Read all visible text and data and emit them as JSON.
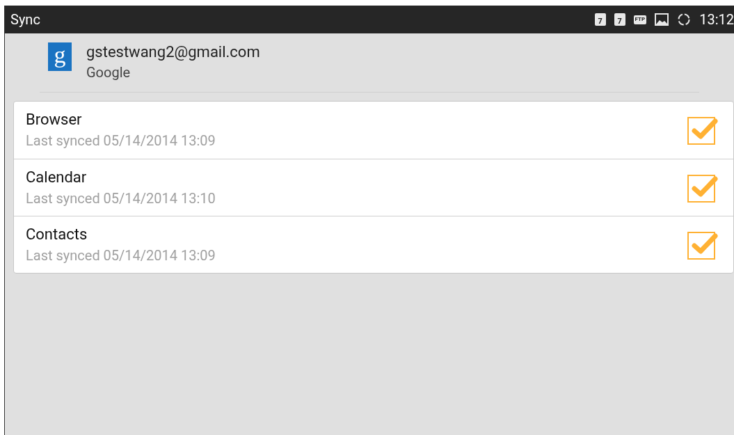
{
  "status_bar": {
    "title": "Sync",
    "icons": [
      {
        "kind": "calendar",
        "text": "7"
      },
      {
        "kind": "calendar",
        "text": "7"
      },
      {
        "kind": "ftp",
        "text": "FTP"
      },
      {
        "kind": "picture"
      },
      {
        "kind": "sync"
      }
    ],
    "time": "13:12"
  },
  "account": {
    "logo_letter": "g",
    "email": "gstestwang2@gmail.com",
    "type": "Google"
  },
  "items": [
    {
      "name": "Browser",
      "last_synced": "Last synced 05/14/2014 13:09",
      "checked": true
    },
    {
      "name": "Calendar",
      "last_synced": "Last synced 05/14/2014 13:10",
      "checked": true
    },
    {
      "name": "Contacts",
      "last_synced": "Last synced 05/14/2014 13:09",
      "checked": true
    }
  ]
}
